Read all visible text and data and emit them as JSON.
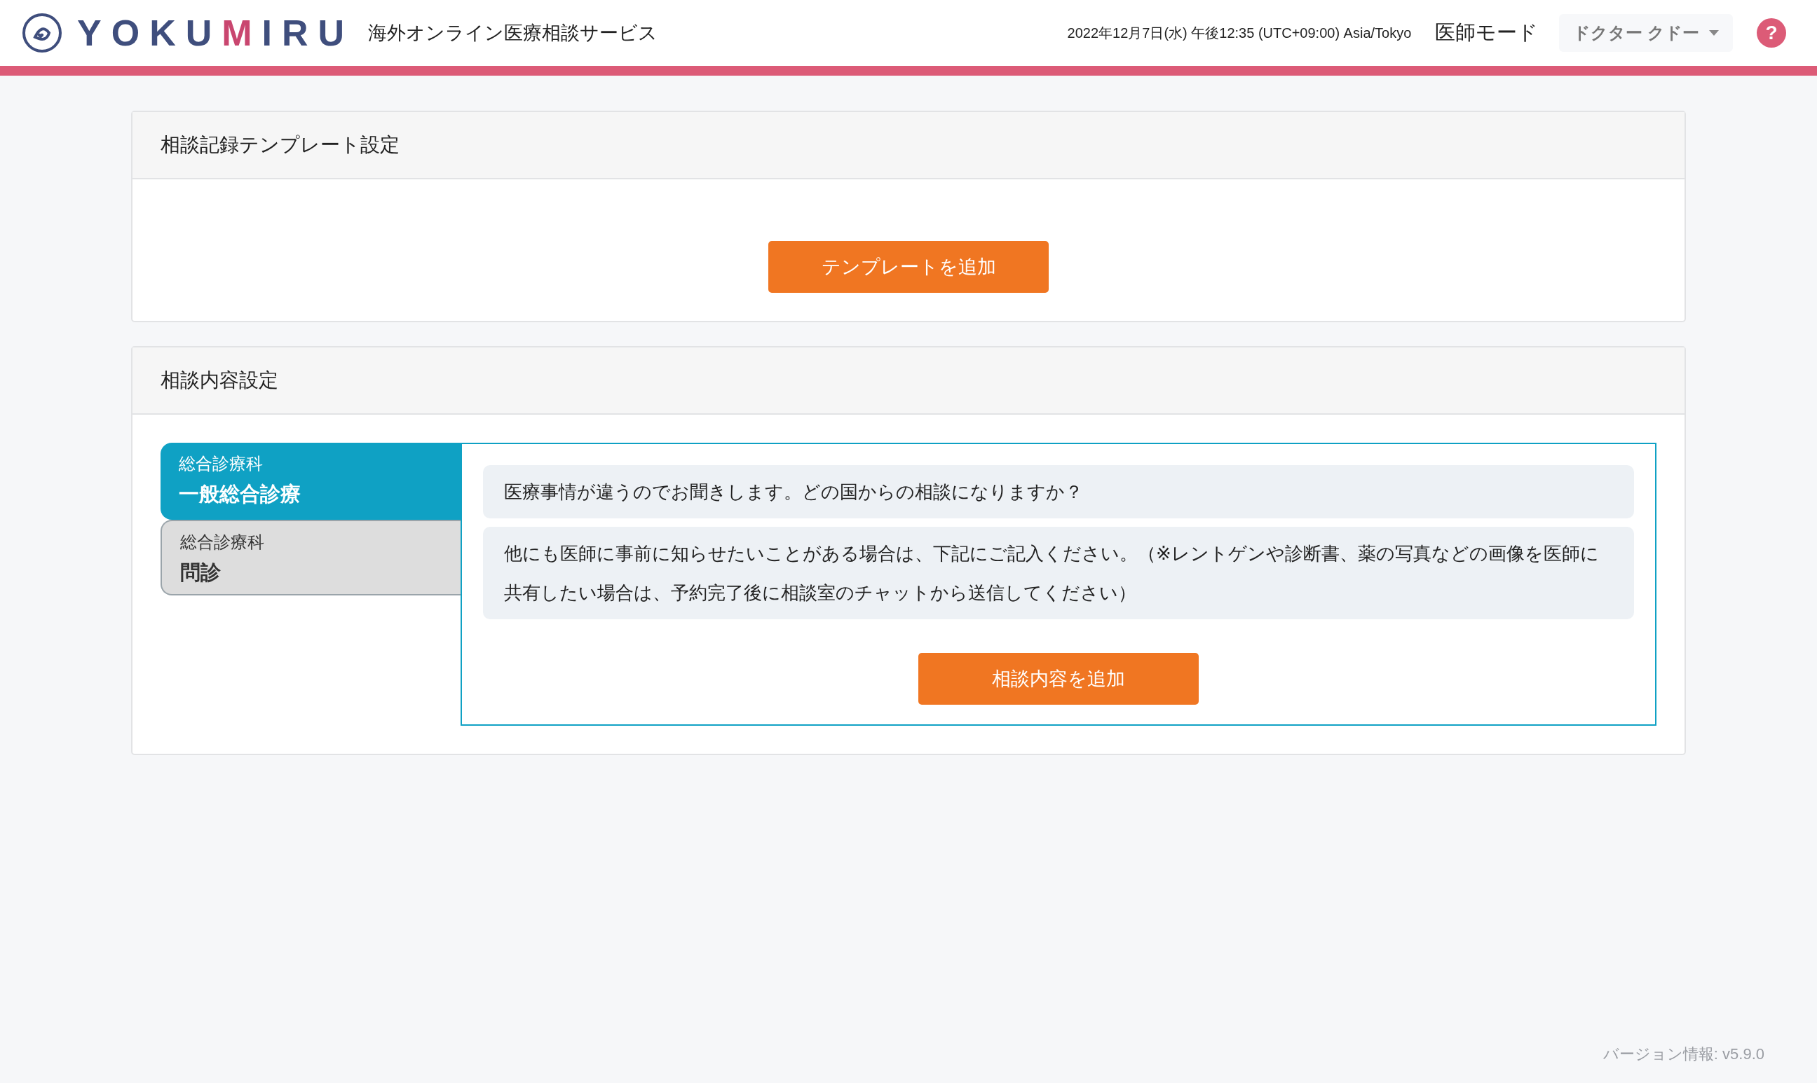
{
  "header": {
    "logo": [
      {
        "text": "YOKU",
        "accent": false
      },
      {
        "text": "M",
        "accent": true
      },
      {
        "text": "IRU",
        "accent": false
      }
    ],
    "service_name": "海外オンライン医療相談サービス",
    "datetime": "2022年12月7日(水) 午後12:35 (UTC+09:00) Asia/Tokyo",
    "mode": "医師モード",
    "user_menu": "ドクター クドー",
    "help": "?"
  },
  "template_card": {
    "title": "相談記録テンプレート設定",
    "button": "テンプレートを追加"
  },
  "content_card": {
    "title": "相談内容設定",
    "tabs": [
      {
        "category": "総合診療科",
        "name": "一般総合診療",
        "selected": true
      },
      {
        "category": "総合診療科",
        "name": "問診",
        "selected": false
      }
    ],
    "questions": [
      "医療事情が違うのでお聞きします。どの国からの相談になりますか？",
      "他にも医師に事前に知らせたいことがある場合は、下記にご記入ください。（※レントゲンや診断書、薬の写真などの画像を医師に共有したい場合は、予約完了後に相談室のチャットから送信してください）"
    ],
    "button": "相談内容を追加"
  },
  "version": "バージョン情報: v5.9.0"
}
